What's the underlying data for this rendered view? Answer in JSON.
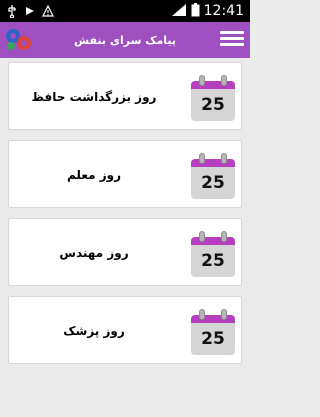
{
  "status_bar": {
    "time": "12:41",
    "icons": [
      "usb-icon",
      "debug-icon",
      "alert-icon",
      "signal-icon",
      "battery-icon"
    ]
  },
  "app_bar": {
    "title": "پیامک سرای بنفش",
    "logo": "gears-logo",
    "menu_icon": "hamburger-menu-icon"
  },
  "items": [
    {
      "label": "روز بزرگداشت حافظ",
      "calendar_day": "25"
    },
    {
      "label": "روز معلم",
      "calendar_day": "25"
    },
    {
      "label": "روز مهندس",
      "calendar_day": "25"
    },
    {
      "label": "روز پزشک",
      "calendar_day": "25"
    }
  ],
  "colors": {
    "app_bar": "#9e4fc0",
    "calendar_header": "#b63fbf",
    "background": "#ebebeb"
  }
}
